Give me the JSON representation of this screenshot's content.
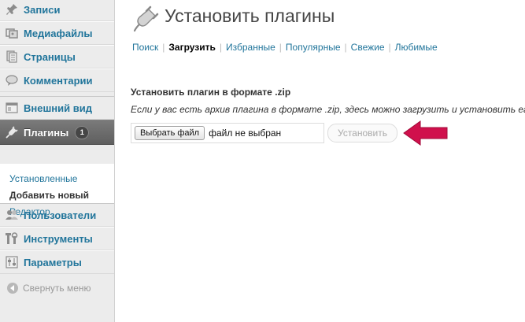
{
  "sidebar": {
    "items": [
      {
        "label": "Записи",
        "icon": "pin-icon"
      },
      {
        "label": "Медиафайлы",
        "icon": "media-icon"
      },
      {
        "label": "Страницы",
        "icon": "pages-icon"
      },
      {
        "label": "Комментарии",
        "icon": "comment-icon"
      },
      {
        "label": "Внешний вид",
        "icon": "appearance-icon"
      },
      {
        "label": "Плагины",
        "icon": "plugin-icon",
        "badge": "1"
      },
      {
        "label": "Пользователи",
        "icon": "users-icon"
      },
      {
        "label": "Инструменты",
        "icon": "tools-icon"
      },
      {
        "label": "Параметры",
        "icon": "settings-icon"
      }
    ],
    "submenu": [
      "Установленные",
      "Добавить новый",
      "Редактор"
    ],
    "collapse_label": "Свернуть меню"
  },
  "main": {
    "page_title": "Установить плагины",
    "tabs": [
      "Поиск",
      "Загрузить",
      "Избранные",
      "Популярные",
      "Свежие",
      "Любимые"
    ],
    "section_title": "Установить плагин в формате .zip",
    "section_desc": "Если у вас есть архив плагина в формате .zip, здесь можно загрузить и установить его.",
    "file_button_label": "Выбрать файл",
    "file_status": "файл не выбран",
    "install_button_label": "Установить"
  },
  "colors": {
    "link": "#21759b",
    "arrow": "#d0104c"
  }
}
